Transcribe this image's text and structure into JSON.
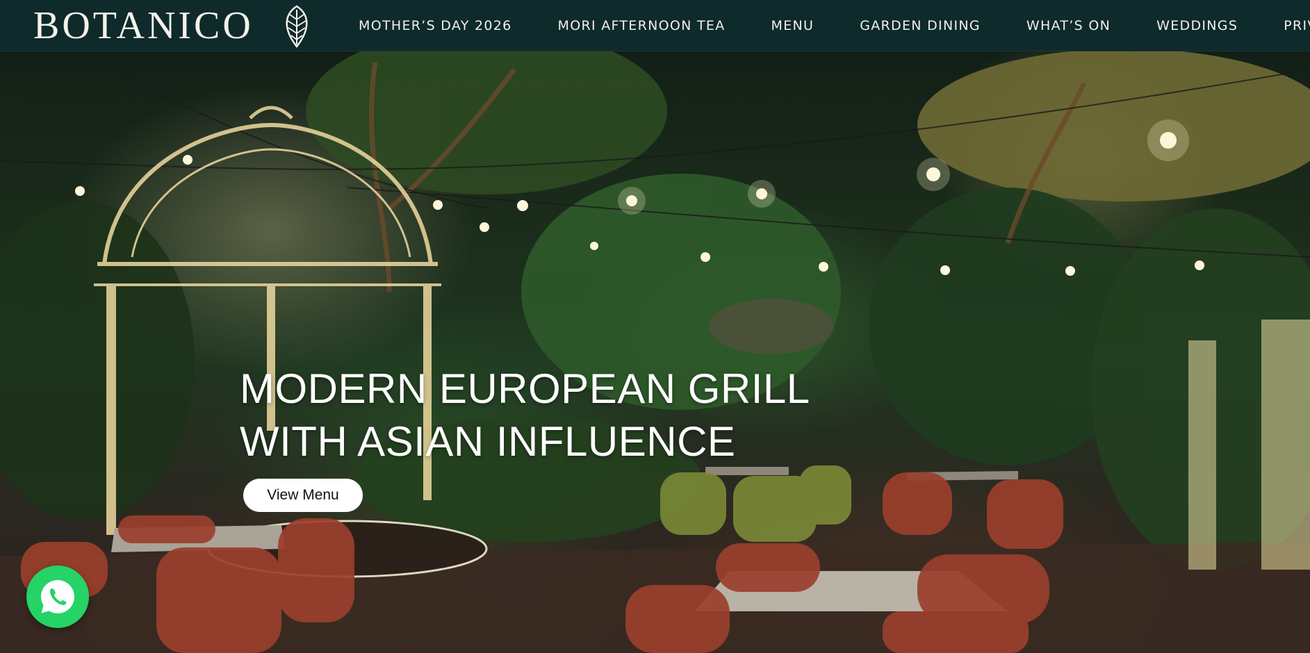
{
  "brand": {
    "name": "BOTANICO",
    "logo_icon": "leaf-icon"
  },
  "nav": {
    "items": [
      {
        "label": "MOTHER’S DAY 2026"
      },
      {
        "label": "MORI AFTERNOON TEA"
      },
      {
        "label": "MENU"
      },
      {
        "label": "GARDEN DINING"
      },
      {
        "label": "WHAT’S ON"
      },
      {
        "label": "WEDDINGS"
      },
      {
        "label": "PRIVATE EV"
      }
    ]
  },
  "hero": {
    "headline_line1": "MODERN EUROPEAN GRILL",
    "headline_line2": "WITH ASIAN INFLUENCE",
    "cta_label": "View Menu"
  },
  "floating": {
    "whatsapp_icon": "whatsapp-icon"
  },
  "colors": {
    "nav_background": "#0f2a2b",
    "nav_text": "#f1f1ec",
    "cta_background": "#ffffff",
    "whatsapp_green": "#25d366"
  }
}
